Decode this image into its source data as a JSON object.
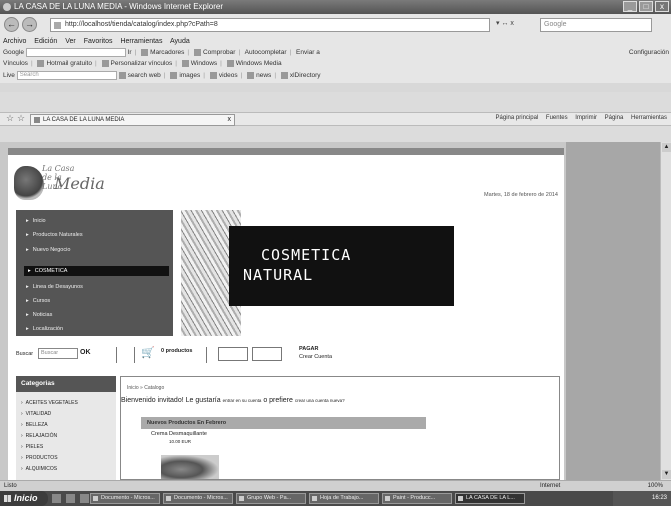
{
  "window": {
    "title": "LA CASA DE LA LUNA MEDIA - Windows Internet Explorer",
    "buttons": [
      "_",
      "□",
      "x"
    ]
  },
  "address": {
    "back": "←",
    "forward": "→",
    "url": "http://localhost/tienda/catalog/index.php?cPath=8",
    "controls": "▾ ↔ x",
    "search_placeholder": "Google"
  },
  "menubar": [
    "Archivo",
    "Edición",
    "Ver",
    "Favoritos",
    "Herramientas",
    "Ayuda"
  ],
  "toolbar_google": {
    "label": "Google",
    "items": [
      "Ir",
      "Marcadores",
      "Comprobar",
      "Autocompletar",
      "Enviar a"
    ],
    "right": "Configuración"
  },
  "toolbar_links": {
    "label": "Vínculos",
    "items": [
      "Hotmail gratuito",
      "Personalizar vínculos",
      "Windows",
      "Windows Media"
    ]
  },
  "toolbar_search": {
    "label": "Live",
    "field": "Search",
    "items": [
      "search web",
      "images",
      "videos",
      "news",
      "xlDirectory"
    ]
  },
  "tabs": {
    "active": "LA CASA DE LA LUNA MEDIA",
    "close": "x",
    "commands": [
      "Página principal",
      "Fuentes",
      "Imprimir",
      "Página",
      "Herramientas"
    ]
  },
  "site": {
    "logo_small": "La Casa de la Luna",
    "logo_big": "Media",
    "date": "Martes, 18 de febrero de 2014",
    "nav": [
      "Inicio",
      "Productos Naturales",
      "Nuevo Negocio",
      "COSMETICA",
      "Linea de Desayunos",
      "Cursos",
      "Noticias",
      "Localización"
    ],
    "active_nav": "COSMETICA",
    "banner_line1": "COSMETICA",
    "banner_line2": "NATURAL",
    "search_label": "Buscar",
    "search_placeholder": "Buscar",
    "search_ok": "OK",
    "cart_icon": "🛒",
    "cart_products": "0 productos",
    "checkout": "PAGAR",
    "create_account": "Crear Cuenta",
    "categories_title": "Categorias",
    "categories": [
      "ACEITES VEGETALES",
      "VITALIDAD",
      "BELLEZA",
      "RELAJACIÓN",
      "PIELES",
      "PRODUCTOS",
      "ALQUIMICOS"
    ],
    "breadcrumb": "Inicio » Catalogo",
    "welcome_main": "Bienvenido invitado! Le gustaría",
    "welcome_link1": "entrar en su cuenta",
    "welcome_mid": "o prefiere",
    "welcome_link2": "crear una cuenta nueva?",
    "section_title": "Nuevos Productos En Febrero",
    "section_sub": "Crema Desmaquillante",
    "section_price": "10.00 EUR"
  },
  "status": {
    "left": "Listo",
    "zone": "Internet",
    "zoom": "100%"
  },
  "taskbar": {
    "start": "Inicio",
    "tasks": [
      "Documento - Micros...",
      "Documento - Micros...",
      "Grupo Web - Pa...",
      "Hoja de Trabajo...",
      "Paint - Producc...",
      "LA CASA DE LA L..."
    ],
    "clock": "16:23"
  }
}
